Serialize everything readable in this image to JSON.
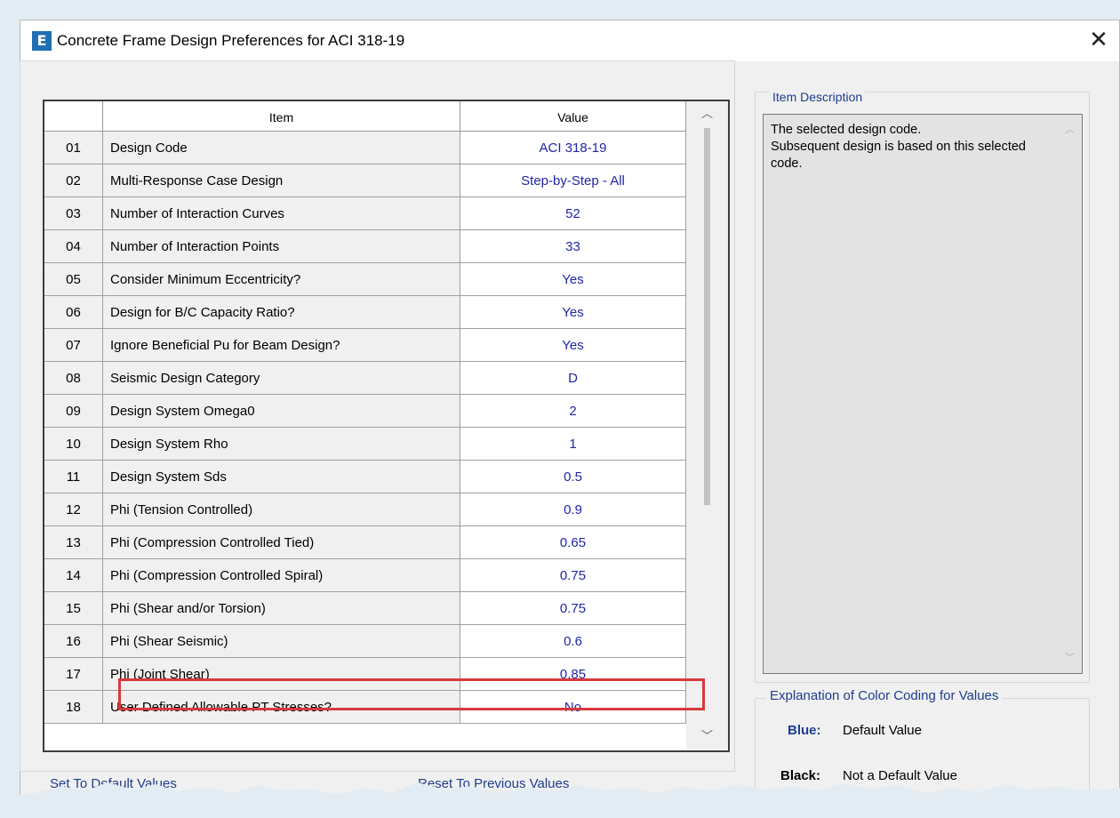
{
  "window": {
    "app_icon": "E",
    "title": "Concrete Frame Design Preferences for ACI 318-19",
    "close_glyph": "✕"
  },
  "grid": {
    "headers": {
      "num": "",
      "item": "Item",
      "value": "Value"
    },
    "rows": [
      {
        "num": "01",
        "item": "Design Code",
        "value": "ACI 318-19"
      },
      {
        "num": "02",
        "item": "Multi-Response Case Design",
        "value": "Step-by-Step - All"
      },
      {
        "num": "03",
        "item": "Number of Interaction Curves",
        "value": "52"
      },
      {
        "num": "04",
        "item": "Number of Interaction Points",
        "value": "33"
      },
      {
        "num": "05",
        "item": "Consider Minimum Eccentricity?",
        "value": "Yes"
      },
      {
        "num": "06",
        "item": "Design for B/C Capacity Ratio?",
        "value": "Yes"
      },
      {
        "num": "07",
        "item": "Ignore Beneficial Pu for Beam Design?",
        "value": "Yes"
      },
      {
        "num": "08",
        "item": "Seismic Design Category",
        "value": "D"
      },
      {
        "num": "09",
        "item": "Design System Omega0",
        "value": "2"
      },
      {
        "num": "10",
        "item": "Design System Rho",
        "value": "1"
      },
      {
        "num": "11",
        "item": "Design System Sds",
        "value": "0.5"
      },
      {
        "num": "12",
        "item": "Phi (Tension Controlled)",
        "value": "0.9"
      },
      {
        "num": "13",
        "item": "Phi (Compression Controlled Tied)",
        "value": "0.65"
      },
      {
        "num": "14",
        "item": "Phi (Compression Controlled Spiral)",
        "value": "0.75"
      },
      {
        "num": "15",
        "item": "Phi (Shear and/or Torsion)",
        "value": "0.75"
      },
      {
        "num": "16",
        "item": "Phi (Shear Seismic)",
        "value": "0.6"
      },
      {
        "num": "17",
        "item": "Phi (Joint Shear)",
        "value": "0.85"
      },
      {
        "num": "18",
        "item": "User Defined Allowable PT Stresses?",
        "value": "No"
      }
    ],
    "value_color": "#1f26a5"
  },
  "description": {
    "legend": "Item Description",
    "text": "The selected design code.\nSubsequent design is based on this selected code."
  },
  "color_coding": {
    "legend": "Explanation of Color Coding for Values",
    "blue_label": "Blue:",
    "blue_text": "Default Value",
    "black_label": "Black:",
    "black_text": "Not a Default Value"
  },
  "buttons": {
    "set_default_partial": "Set To Default Values",
    "reset_previous_partial": "Reset To Previous Values"
  },
  "highlight_color": "#d9393c"
}
